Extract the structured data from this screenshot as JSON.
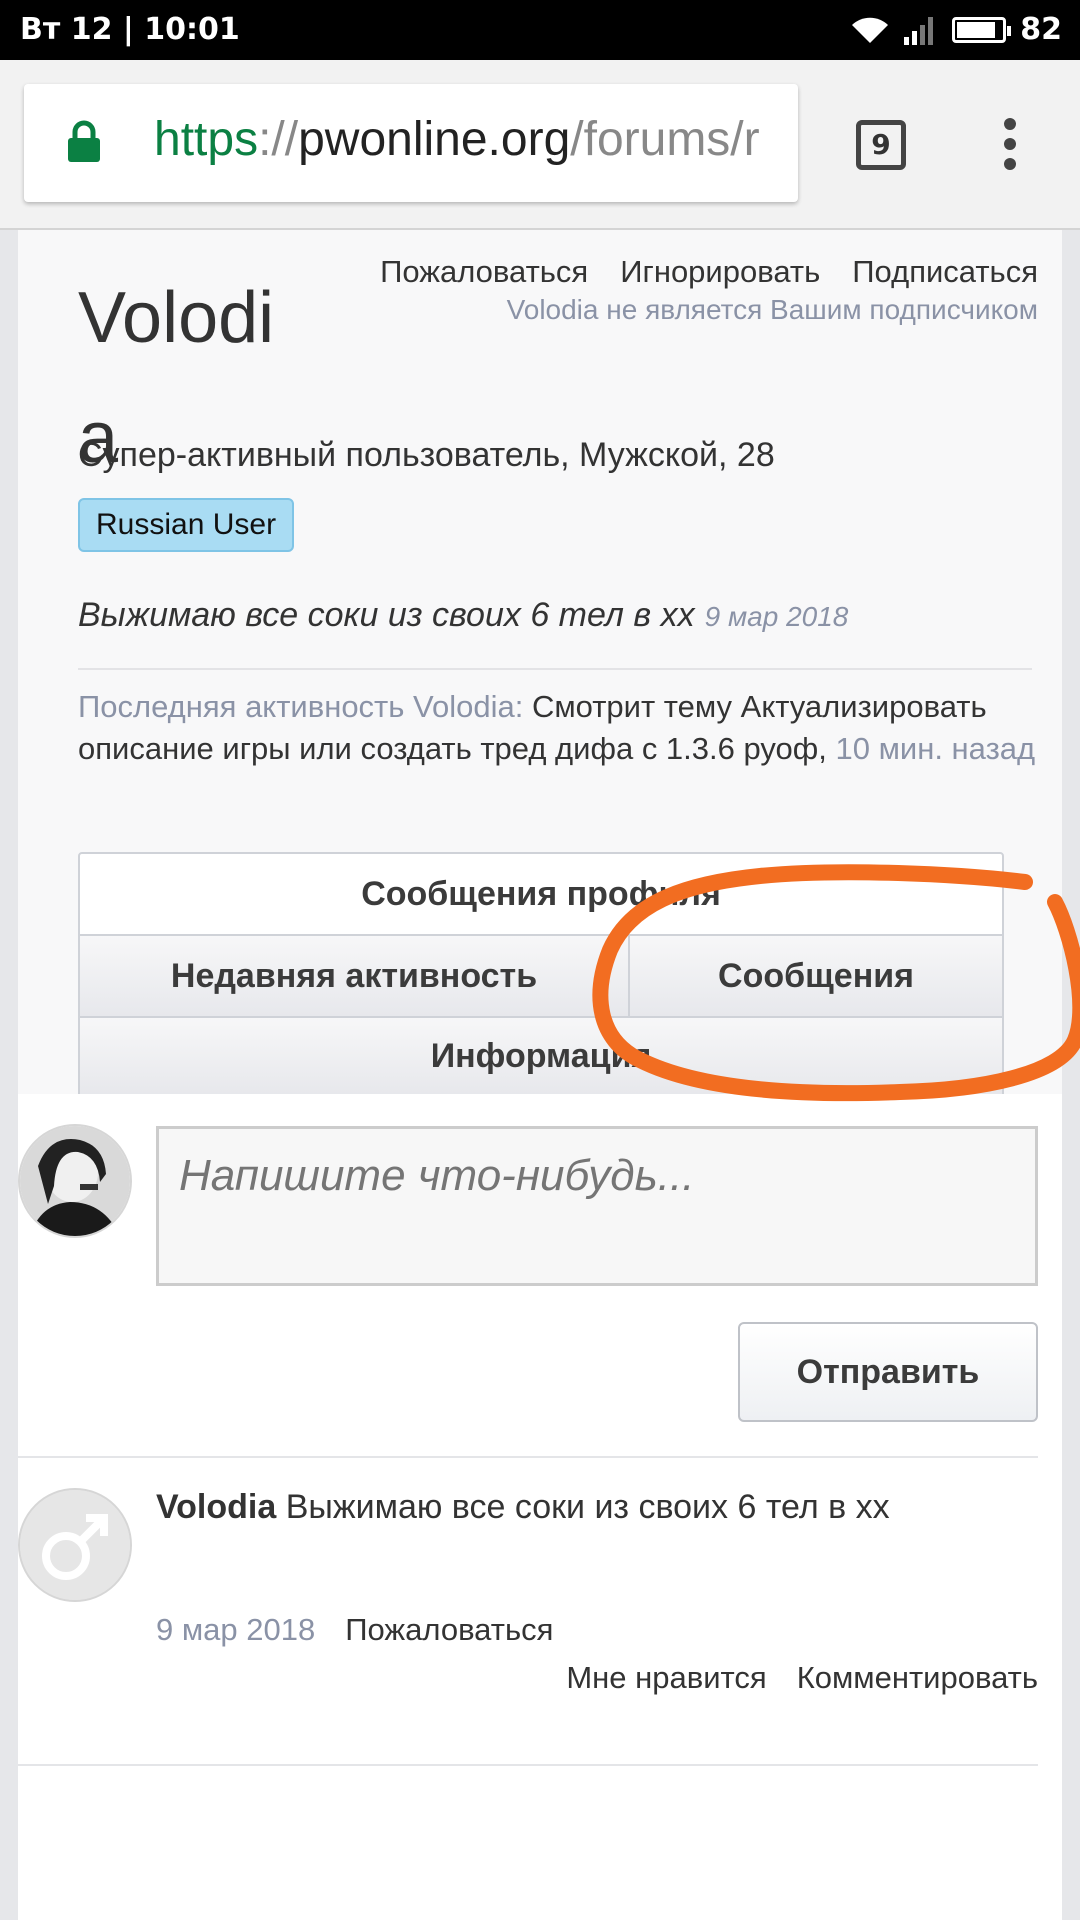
{
  "status_bar": {
    "time": "Вт 12 | 10:01",
    "battery": "82",
    "battery_level": 0.82
  },
  "browser": {
    "url_scheme": "https",
    "url_sep": "://",
    "url_host": "pwonline.org",
    "url_path": "/forums/r",
    "tab_count": "9"
  },
  "profile": {
    "name": "Volodia",
    "report_label": "Пожаловаться",
    "ignore_label": "Игнорировать",
    "follow_label": "Подписаться",
    "follow_note": "Volodia не является Вашим подписчиком",
    "subtitle": "Супер-активный пользователь, Мужской, 28",
    "badge": "Russian User",
    "status_text": "Выжимаю все соки из своих 6 тел в хх",
    "status_date": "9 мар 2018",
    "activity_prefix": "Последняя активность Volodia:",
    "activity_text": " Смотрит тему Актуализировать описание игры или создать тред дифа с 1.3.6 руоф,",
    "activity_time": "10 мин. назад"
  },
  "tabs": {
    "profile_posts": "Сообщения профиля",
    "recent_activity": "Недавняя активность",
    "posts": "Сообщения",
    "information": "Информация"
  },
  "compose": {
    "placeholder": "Напишите что-нибудь...",
    "send_label": "Отправить"
  },
  "post": {
    "author": "Volodia",
    "text": "Выжимаю все соки из своих 6 тел в хх",
    "date": "9 мар 2018",
    "report_label": "Пожаловаться",
    "like_label": "Мне нравится",
    "comment_label": "Комментировать"
  },
  "colors": {
    "annotation": "#f26d21",
    "url_green": "#0b8043",
    "badge_bg": "#a9dcf3"
  }
}
